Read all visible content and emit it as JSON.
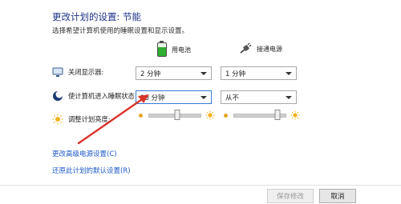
{
  "header": {
    "title": "更改计划的设置: 节能",
    "subtitle": "选择希望计算机使用的睡眠设置和显示设置。"
  },
  "columns": {
    "battery_label": "用电池",
    "plugged_label": "接通电源"
  },
  "rows": [
    {
      "label": "关闭显示器:",
      "icon": "display-icon",
      "battery_value": "2 分钟",
      "plugged_value": "1 分钟"
    },
    {
      "label": "使计算机进入睡眠状态:",
      "icon": "moon-sleep-icon",
      "battery_value": "10 分钟",
      "plugged_value": "从不"
    }
  ],
  "brightness": {
    "label": "调整计划亮度:",
    "battery_level": 0.55,
    "plugged_level": 0.85
  },
  "links": {
    "advanced": "更改高级电源设置(C)",
    "restore": "还原此计划的默认设置(R)"
  },
  "footer": {
    "save_label": "保存修改",
    "cancel_label": "取消"
  },
  "colors": {
    "title": "#1e3287",
    "link": "#1d59c9",
    "annotation_arrow": "#d9342b"
  }
}
